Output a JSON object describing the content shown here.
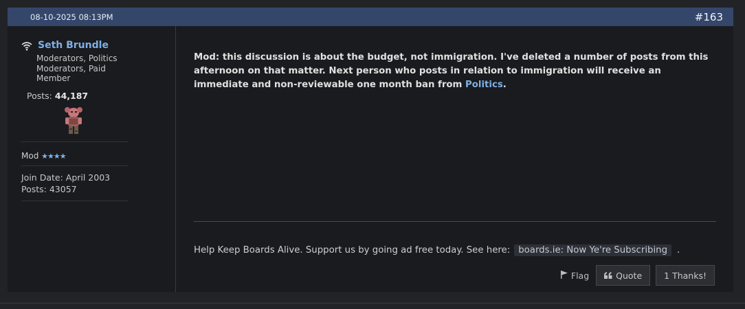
{
  "post": {
    "date": "08-10-2025 08:13PM",
    "number": "#163"
  },
  "author": {
    "name": "Seth Brundle",
    "roles": "Moderators, Politics Moderators, Paid Member",
    "posts_label": "Posts:",
    "posts_value": "44,187",
    "rank": "Mod",
    "stars": "★★★★",
    "join_date": "Join Date: April 2003",
    "posts_count": "Posts: 43057"
  },
  "message": {
    "text": "Mod: this discussion is about the budget, not immigration. I've deleted a number of posts from this afternoon on that matter. Next person who posts in relation to immigration will receive an immediate and non-reviewable one month ban from ",
    "link": "Politics",
    "end": "."
  },
  "signature": {
    "text": "Help Keep Boards Alive. Support us by going ad free today. See here:",
    "link": "boards.ie: Now Ye're Subscribing",
    "end": "."
  },
  "actions": {
    "flag": "Flag",
    "quote": "Quote",
    "thanks": "1 Thanks!"
  },
  "icons": {
    "online": "wifi-icon",
    "flag": "flag-icon",
    "quote": "quote-icon"
  },
  "colors": {
    "header": "#34476b",
    "link": "#7fb0e6",
    "background": "#1a1b1e"
  }
}
